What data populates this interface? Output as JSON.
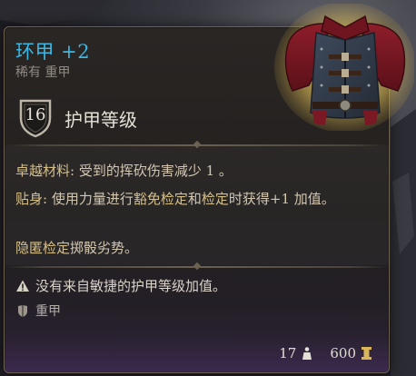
{
  "item": {
    "name": "环甲 +2",
    "subtitle": "稀有 重甲",
    "armour_class": "16",
    "armour_class_label": "护甲等级"
  },
  "passives": {
    "p1_name": "卓越材料:",
    "p1_text": "受到的挥砍伤害减少 1 。",
    "p2_name": "贴身:",
    "p2_text_a": "使用力量进行",
    "p2_kw1": "豁免检定",
    "p2_text_b": "和",
    "p2_kw2": "检定",
    "p2_text_c": "时获得+1 加值。",
    "p3_kw": "隐匿检定",
    "p3_text": "掷骰劣势。"
  },
  "warnings": {
    "no_dex": "没有来自敏捷的护甲等级加值。",
    "no_dex_icon": "warning-triangle-icon",
    "type_label": "重甲",
    "type_icon": "heavy-armour-icon"
  },
  "footer": {
    "weight": "17",
    "weight_icon": "weight-icon",
    "value": "600",
    "value_icon": "gold-icon"
  },
  "colors": {
    "title": "#3ab9e6",
    "keyword": "#d6c08a",
    "text": "#d3c7b2"
  }
}
